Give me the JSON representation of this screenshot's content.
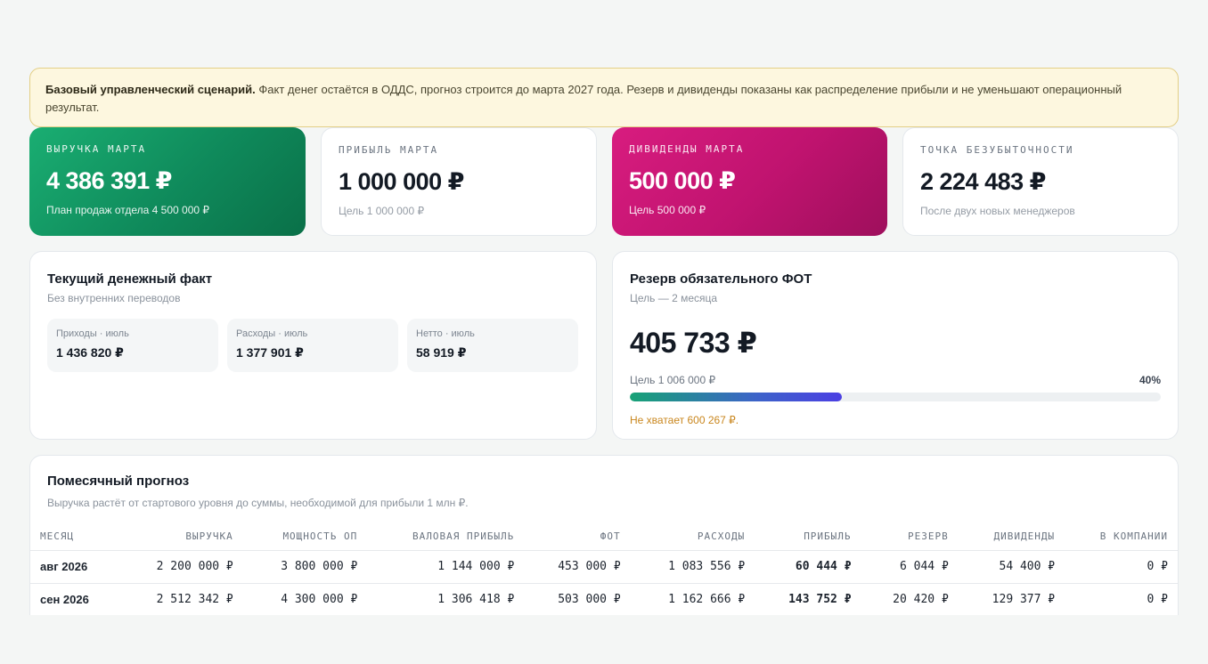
{
  "notice": {
    "bold": "Базовый управленческий сценарий.",
    "text": " Факт денег остаётся в ОДДС, прогноз строится до марта 2027 года. Резерв и дивиденды показаны как распределение прибыли и не уменьшают операционный результат."
  },
  "kpis": [
    {
      "label": "Выручка марта",
      "value": "4 386 391 ₽",
      "sub": "План продаж отдела 4 500 000 ₽"
    },
    {
      "label": "Прибыль марта",
      "value": "1 000 000 ₽",
      "sub": "Цель 1 000 000 ₽"
    },
    {
      "label": "Дивиденды марта",
      "value": "500 000 ₽",
      "sub": "Цель 500 000 ₽"
    },
    {
      "label": "Точка безубыточности",
      "value": "2 224 483 ₽",
      "sub": "После двух новых менеджеров"
    }
  ],
  "cash_fact": {
    "title": "Текущий денежный факт",
    "subtitle": "Без внутренних переводов",
    "tiles": [
      {
        "label": "Приходы · июль",
        "value": "1 436 820 ₽"
      },
      {
        "label": "Расходы · июль",
        "value": "1 377 901 ₽"
      },
      {
        "label": "Нетто · июль",
        "value": "58 919 ₽"
      }
    ]
  },
  "reserve": {
    "title": "Резерв обязательного ФОТ",
    "subtitle": "Цель — 2 месяца",
    "value": "405 733 ₽",
    "goal": "Цель 1 006 000 ₽",
    "percent_label": "40%",
    "progress": 0.4,
    "shortfall": "Не хватает 600 267 ₽."
  },
  "forecast": {
    "title": "Помесячный прогноз",
    "subtitle": "Выручка растёт от стартового уровня до суммы, необходимой для прибыли 1 млн ₽.",
    "columns": [
      "Месяц",
      "Выручка",
      "Мощность ОП",
      "Валовая прибыль",
      "ФОТ",
      "Расходы",
      "Прибыль",
      "Резерв",
      "Дивиденды",
      "В компании"
    ],
    "rows": [
      [
        "авг 2026",
        "2 200 000 ₽",
        "3 800 000 ₽",
        "1 144 000 ₽",
        "453 000 ₽",
        "1 083 556 ₽",
        "60 444 ₽",
        "6 044 ₽",
        "54 400 ₽",
        "0 ₽"
      ],
      [
        "сен 2026",
        "2 512 342 ₽",
        "4 300 000 ₽",
        "1 306 418 ₽",
        "503 000 ₽",
        "1 162 666 ₽",
        "143 752 ₽",
        "20 420 ₽",
        "129 377 ₽",
        "0 ₽"
      ]
    ]
  },
  "colors": {
    "accent_green": "#0f8a5b",
    "accent_pink": "#c0136f",
    "warning": "#c9861d"
  }
}
